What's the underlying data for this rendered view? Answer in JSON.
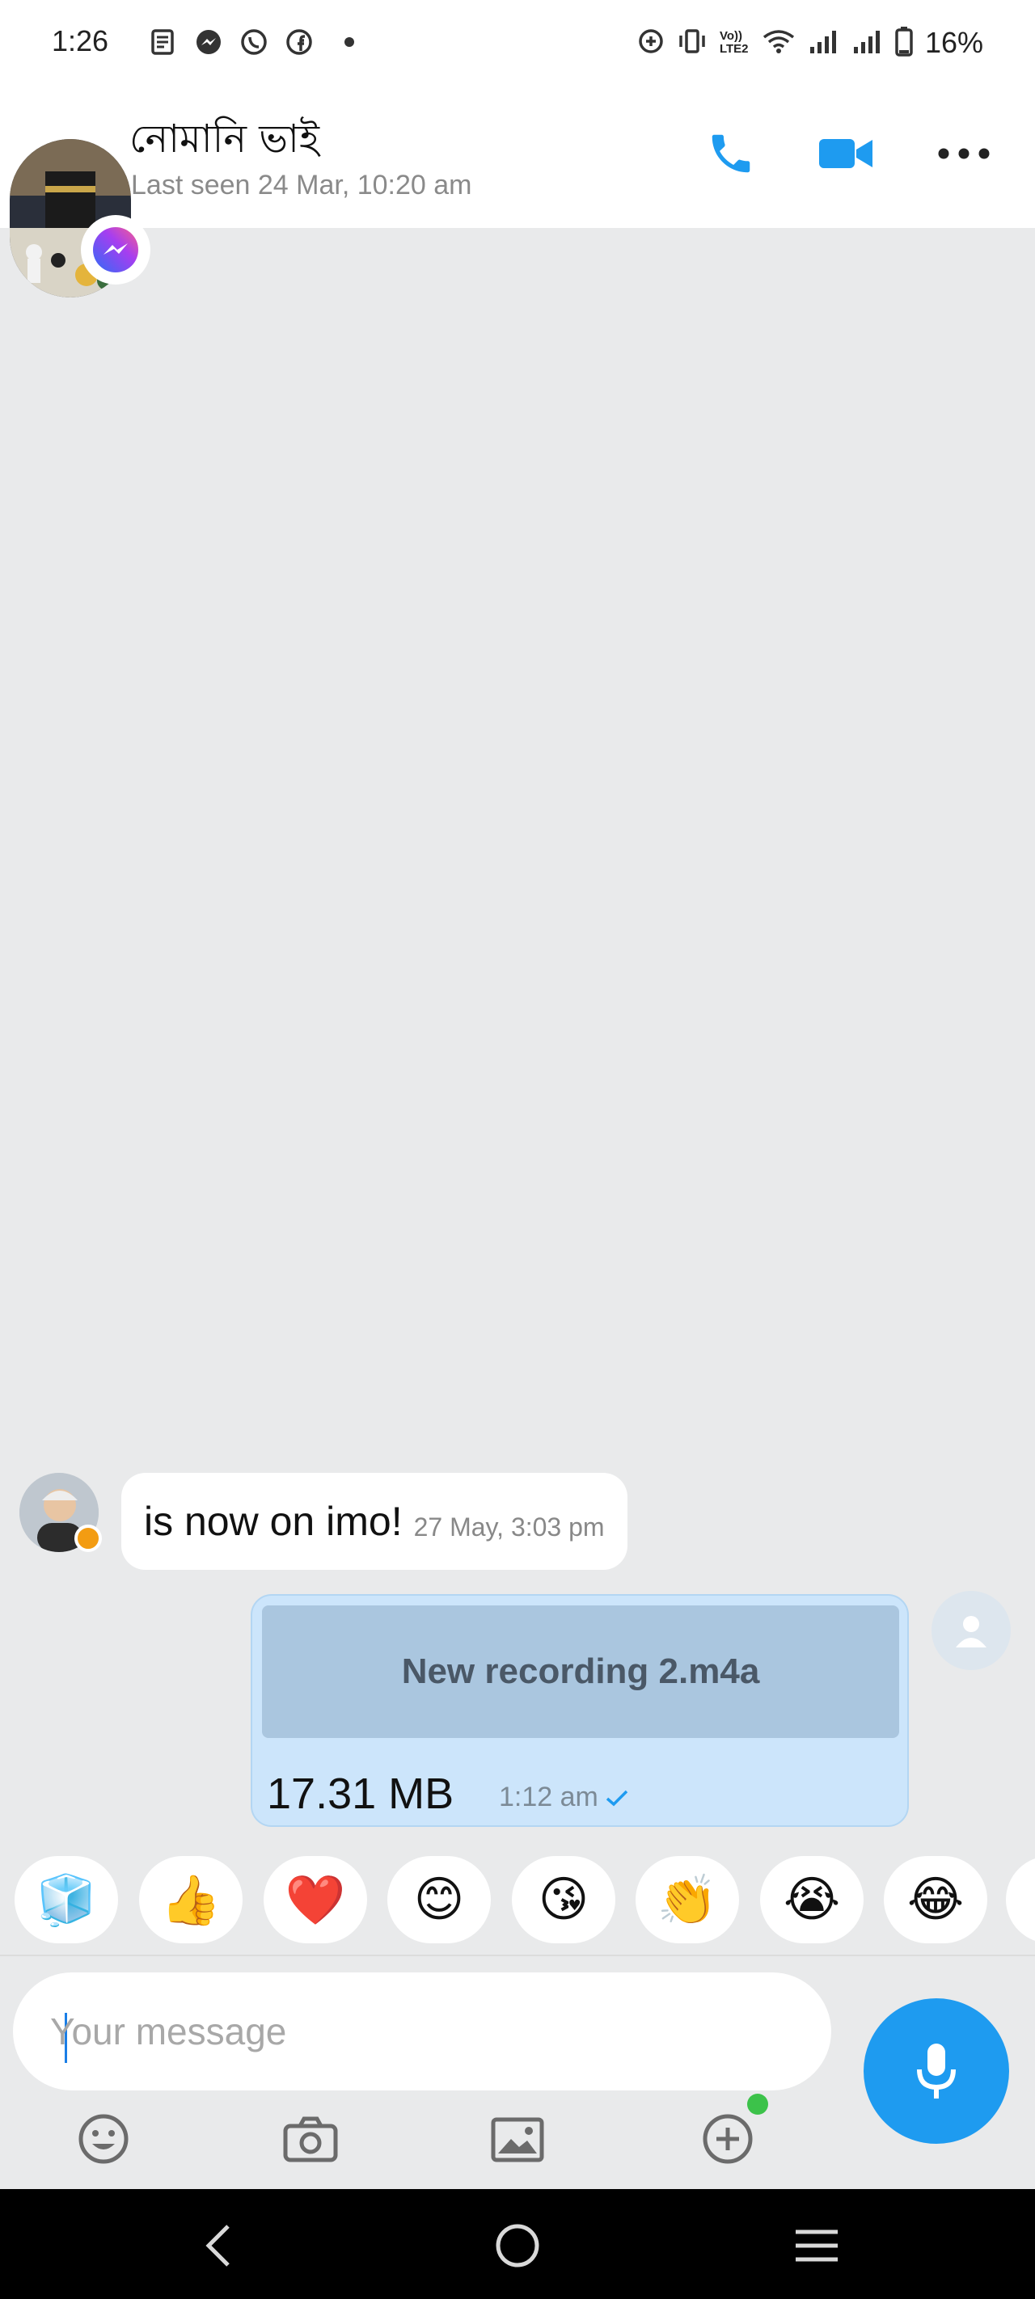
{
  "status_bar": {
    "time": "1:26",
    "battery": "16%",
    "network_label": "Vo)) LTE2",
    "notification_icons": [
      "news-icon",
      "messenger-icon",
      "whatsapp-icon",
      "facebook-icon",
      "dot-icon"
    ]
  },
  "header": {
    "contact_name": "নোমানি ভাই",
    "last_seen": "Last seen 24 Mar, 10:20 am",
    "actions": [
      "phone-icon",
      "video-icon",
      "more-icon"
    ],
    "accent_color": "#1e9bf0"
  },
  "messages": {
    "incoming": {
      "text": "is now on imo!",
      "time": "27 May, 3:03 pm"
    },
    "outgoing": {
      "file_name": "New recording 2.m4a",
      "file_size": "17.31 MB",
      "time": "1:12 am",
      "status": "sent"
    }
  },
  "quick_reactions": [
    "🧊",
    "👍",
    "❤️",
    "😊",
    "😘",
    "👏",
    "😭",
    "😂"
  ],
  "composer": {
    "placeholder": "Your message",
    "value": "",
    "tools": [
      "emoji-icon",
      "camera-icon",
      "gallery-icon",
      "add-icon"
    ]
  }
}
